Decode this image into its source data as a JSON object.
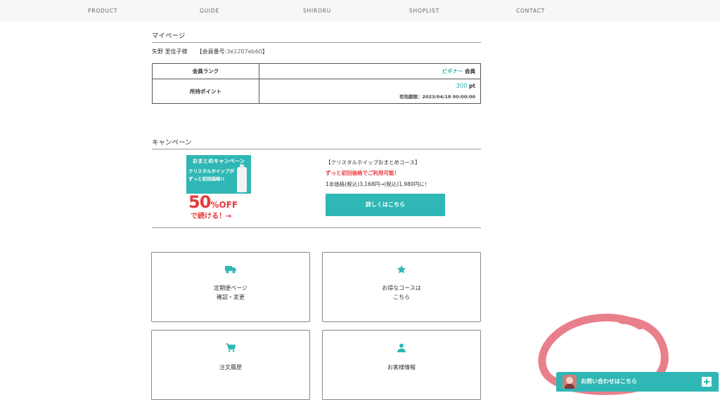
{
  "nav": {
    "items": [
      {
        "label": "PRODUCT"
      },
      {
        "label": "GUIDE"
      },
      {
        "label": "SHIRORU"
      },
      {
        "label": "SHOPLIST"
      },
      {
        "label": "CONTACT"
      }
    ]
  },
  "mypage": {
    "title": "マイページ",
    "member_name": "矢野 里佳子様",
    "member_id_label": "【会員番号:",
    "member_id": "3e1207eb60",
    "member_id_close": "】",
    "rank_label": "会員ランク",
    "rank_value": "ビギナー",
    "rank_suffix": "会員",
    "points_label": "所持ポイント",
    "points_value": "300",
    "points_unit": "pt",
    "expiry": "有効期限：2023/04/18 00:00:00"
  },
  "campaign": {
    "title": "キャンペーン",
    "banner": {
      "head": "おまとめキャンペーン",
      "line1": "クリスタルホイップが",
      "line2": "ずっと初回価格!!",
      "big": "50",
      "big_suffix": "%OFF",
      "tail": "で続ける！→"
    },
    "heading": "【クリスタルホイップおまとめコース】",
    "subheading": "ずっと初回価格でご利用可能！",
    "price": "1本価格(税込)3,168円→(税込)1,980円に！",
    "button": "詳しくはこちら"
  },
  "cards": [
    {
      "icon": "truck-icon",
      "line1": "定期便ページ",
      "line2": "確認・変更"
    },
    {
      "icon": "star-icon",
      "line1": "お得なコースは",
      "line2": "こちら"
    },
    {
      "icon": "cart-icon",
      "line1": "注文履歴",
      "line2": ""
    },
    {
      "icon": "user-icon",
      "line1": "お客様情報",
      "line2": ""
    }
  ],
  "chat": {
    "label": "お問い合わせはこちら"
  },
  "colors": {
    "accent": "#2fb7b5",
    "alert_red": "#e8383d",
    "annotation_pink": "#e8717f"
  }
}
